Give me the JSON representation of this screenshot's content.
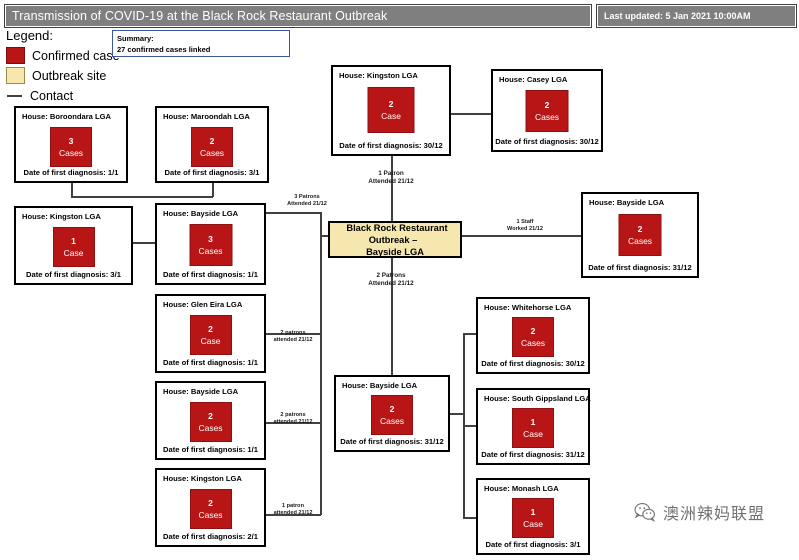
{
  "header": {
    "title": "Transmission of COVID-19 at the Black Rock Restaurant Outbreak",
    "last_updated": "Last updated: 5 Jan 2021 10:00AM"
  },
  "legend": {
    "title": "Legend:",
    "items": [
      {
        "swatch": "confirmed-case-swatch",
        "label": "Confirmed case",
        "color": "#b81616"
      },
      {
        "swatch": "outbreak-site-swatch",
        "label": "Outbreak site",
        "color": "#f5e7ae"
      },
      {
        "swatch": "contact-line-swatch",
        "label": "Contact",
        "color": "#404040"
      }
    ]
  },
  "summary": {
    "heading": "Summary:",
    "text": "27 confirmed cases linked"
  },
  "outbreak": {
    "line1": "Black Rock Restaurant Outbreak –",
    "line2": "Bayside LGA"
  },
  "nodes": {
    "kingston_top": {
      "house": "House: Kingston LGA",
      "count": "2",
      "case_label": "Case",
      "date": "Date of first diagnosis: 30/12"
    },
    "casey": {
      "house": "House: Casey LGA",
      "count": "2",
      "case_label": "Cases",
      "date": "Date of first diagnosis: 30/12"
    },
    "boroondara": {
      "house": "House: Boroondara LGA",
      "count": "3",
      "case_label": "Cases",
      "date": "Date of first diagnosis: 1/1"
    },
    "maroondah": {
      "house": "House: Maroondah LGA",
      "count": "2",
      "case_label": "Cases",
      "date": "Date of first diagnosis: 3/1"
    },
    "kingston_left": {
      "house": "House: Kingston LGA",
      "count": "1",
      "case_label": "Case",
      "date": "Date of first diagnosis: 3/1"
    },
    "bayside_left": {
      "house": "House: Bayside LGA",
      "count": "3",
      "case_label": "Cases",
      "date": "Date of first diagnosis: 1/1"
    },
    "glen_eira": {
      "house": "House: Glen Eira LGA",
      "count": "2",
      "case_label": "Case",
      "date": "Date of first diagnosis: 1/1"
    },
    "bayside_mid": {
      "house": "House: Bayside LGA",
      "count": "2",
      "case_label": "Cases",
      "date": "Date of first diagnosis: 1/1"
    },
    "kingston_bottom": {
      "house": "House: Kingston LGA",
      "count": "2",
      "case_label": "Cases",
      "date": "Date of first diagnosis: 2/1"
    },
    "bayside_right": {
      "house": "House: Bayside LGA",
      "count": "2",
      "case_label": "Cases",
      "date": "Date of first diagnosis: 31/12"
    },
    "bayside_bottom": {
      "house": "House: Bayside LGA",
      "count": "2",
      "case_label": "Cases",
      "date": "Date of first diagnosis: 31/12"
    },
    "whitehorse": {
      "house": "House: Whitehorse LGA",
      "count": "2",
      "case_label": "Cases",
      "date": "Date of first diagnosis: 30/12"
    },
    "south_gippsland": {
      "house": "House: South Gippsland LGA",
      "count": "1",
      "case_label": "Case",
      "date": "Date of first diagnosis: 31/12"
    },
    "monash": {
      "house": "House: Monash LGA",
      "count": "1",
      "case_label": "Case",
      "date": "Date of first diagnosis: 3/1"
    }
  },
  "edges": {
    "patron_top_l1": "1 Patron",
    "patron_top_l2": "Attended 21/12",
    "patrons_left_l1": "3 Patrons",
    "patrons_left_l2": "Attended 21/12",
    "staff_right_l1": "1 Staff",
    "staff_right_l2": "Worked 21/12",
    "patrons_bottom_l1": "2 Patrons",
    "patrons_bottom_l2": "Attended 21/12",
    "glen_eira_l1": "2 patrons",
    "glen_eira_l2": "attended 21/12",
    "bayside_mid_l1": "2 patrons",
    "bayside_mid_l2": "attended 21/12",
    "kingston_bottom_l1": "1 patron",
    "kingston_bottom_l2": "attended 21/12"
  },
  "watermark": {
    "text": "澳洲辣妈联盟"
  },
  "chart_data": {
    "type": "diagram",
    "title": "Transmission of COVID-19 at the Black Rock Restaurant Outbreak",
    "total_confirmed_cases": 27,
    "central_site": "Black Rock Restaurant Outbreak – Bayside LGA",
    "households": [
      {
        "name": "Kingston LGA",
        "cases": 2,
        "first_diagnosis": "30/12",
        "position": "top-center"
      },
      {
        "name": "Casey LGA",
        "cases": 2,
        "first_diagnosis": "30/12",
        "position": "top-right"
      },
      {
        "name": "Boroondara LGA",
        "cases": 3,
        "first_diagnosis": "1/1",
        "position": "left-upper"
      },
      {
        "name": "Maroondah LGA",
        "cases": 2,
        "first_diagnosis": "3/1",
        "position": "left-upper"
      },
      {
        "name": "Kingston LGA",
        "cases": 1,
        "first_diagnosis": "3/1",
        "position": "left"
      },
      {
        "name": "Bayside LGA",
        "cases": 3,
        "first_diagnosis": "1/1",
        "position": "left"
      },
      {
        "name": "Glen Eira LGA",
        "cases": 2,
        "first_diagnosis": "1/1",
        "position": "left-mid"
      },
      {
        "name": "Bayside LGA",
        "cases": 2,
        "first_diagnosis": "1/1",
        "position": "left-mid"
      },
      {
        "name": "Kingston LGA",
        "cases": 2,
        "first_diagnosis": "2/1",
        "position": "left-bottom"
      },
      {
        "name": "Bayside LGA",
        "cases": 2,
        "first_diagnosis": "31/12",
        "position": "right"
      },
      {
        "name": "Bayside LGA",
        "cases": 2,
        "first_diagnosis": "31/12",
        "position": "bottom-center"
      },
      {
        "name": "Whitehorse LGA",
        "cases": 2,
        "first_diagnosis": "30/12",
        "position": "bottom-right"
      },
      {
        "name": "South Gippsland LGA",
        "cases": 1,
        "first_diagnosis": "31/12",
        "position": "bottom-right"
      },
      {
        "name": "Monash LGA",
        "cases": 1,
        "first_diagnosis": "3/1",
        "position": "bottom-right"
      }
    ],
    "links": [
      {
        "from": "Black Rock Restaurant Outbreak",
        "to": "Kingston LGA (top)",
        "label": "1 Patron Attended 21/12"
      },
      {
        "from": "Kingston LGA (top)",
        "to": "Casey LGA",
        "label": "contact"
      },
      {
        "from": "Black Rock Restaurant Outbreak",
        "to": "Bayside LGA (right)",
        "label": "1 Staff Worked 21/12"
      },
      {
        "from": "Black Rock Restaurant Outbreak",
        "to": "Bayside LGA (left)",
        "label": "3 Patrons Attended 21/12"
      },
      {
        "from": "Black Rock Restaurant Outbreak",
        "to": "Glen Eira LGA",
        "label": "2 patrons attended 21/12"
      },
      {
        "from": "Black Rock Restaurant Outbreak",
        "to": "Bayside LGA (left-mid)",
        "label": "2 patrons attended 21/12"
      },
      {
        "from": "Black Rock Restaurant Outbreak",
        "to": "Kingston LGA (bottom)",
        "label": "1 patron attended 21/12"
      },
      {
        "from": "Black Rock Restaurant Outbreak",
        "to": "Bayside LGA (bottom)",
        "label": "2 Patrons Attended 21/12"
      },
      {
        "from": "Bayside LGA (bottom)",
        "to": "Whitehorse LGA",
        "label": "contact"
      },
      {
        "from": "Bayside LGA (bottom)",
        "to": "South Gippsland LGA",
        "label": "contact"
      },
      {
        "from": "Bayside LGA (bottom)",
        "to": "Monash LGA",
        "label": "contact"
      },
      {
        "from": "Bayside LGA (left)",
        "to": "Boroondara LGA",
        "label": "contact"
      },
      {
        "from": "Bayside LGA (left)",
        "to": "Maroondah LGA",
        "label": "contact"
      },
      {
        "from": "Bayside LGA (left)",
        "to": "Kingston LGA (left)",
        "label": "contact"
      }
    ]
  }
}
